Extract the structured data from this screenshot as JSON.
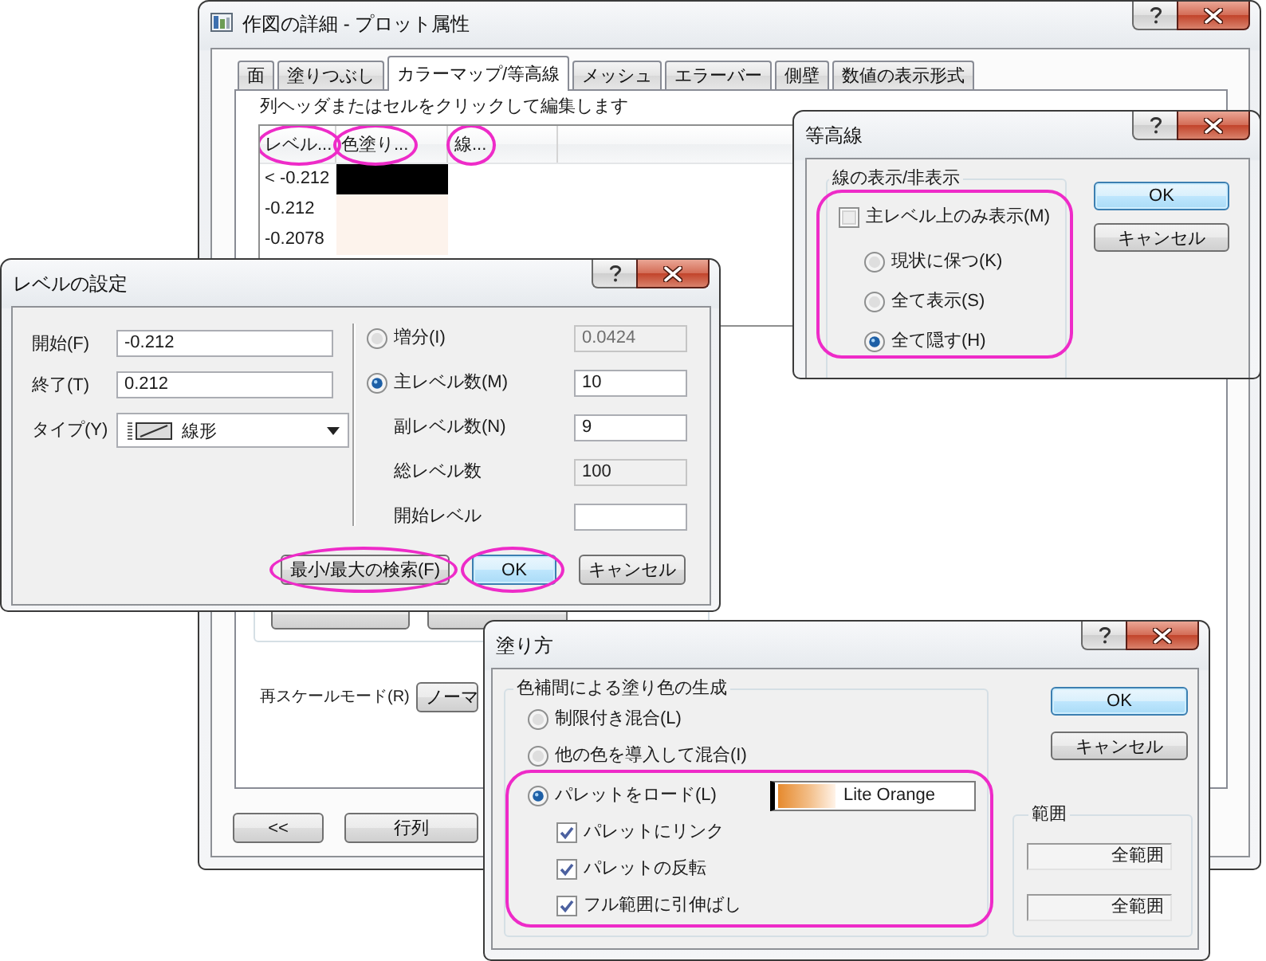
{
  "main_window": {
    "title": "作図の詳細 - プロット属性",
    "tabs": [
      {
        "label": "面",
        "selected": false
      },
      {
        "label": "塗りつぶし",
        "selected": false
      },
      {
        "label": "カラーマップ/等高線",
        "selected": true
      },
      {
        "label": "メッシュ",
        "selected": false
      },
      {
        "label": "エラーバー",
        "selected": false
      },
      {
        "label": "側壁",
        "selected": false
      },
      {
        "label": "数値の表示形式",
        "selected": false
      }
    ],
    "instruction": "列ヘッダまたはセルをクリックして編集します",
    "table": {
      "columns": [
        {
          "label": "レベル...",
          "highlighted": true
        },
        {
          "label": "色塗り...",
          "highlighted": true
        },
        {
          "label": "線...",
          "highlighted": true
        }
      ],
      "rows": [
        {
          "level": "< -0.212",
          "color": "#000000"
        },
        {
          "level": "-0.212",
          "color": "#fdf3ec"
        },
        {
          "level": "-0.2078",
          "color": "#fdf3ec"
        }
      ]
    },
    "rescale": {
      "label": "再スケールモード(R)",
      "value": "ノーマ"
    },
    "buttons": [
      "<<",
      "行列"
    ]
  },
  "level_dialog": {
    "title": "レベルの設定",
    "fields": [
      {
        "label": "開始(F)",
        "value": "-0.212"
      },
      {
        "label": "終了(T)",
        "value": "0.212"
      }
    ],
    "type": {
      "label": "タイプ(Y)",
      "value": "線形"
    },
    "options": [
      {
        "kind": "radio",
        "label": "増分(I)",
        "selected": false,
        "value": "0.0424",
        "disabled": true,
        "read_only": false
      },
      {
        "kind": "radio",
        "label": "主レベル数(M)",
        "selected": true,
        "value": "10",
        "disabled": false,
        "read_only": false
      },
      {
        "kind": "plain",
        "label": "副レベル数(N)",
        "value": "9",
        "disabled": false,
        "read_only": false
      },
      {
        "kind": "plain",
        "label": "総レベル数",
        "value": "100",
        "disabled": false,
        "read_only": true
      },
      {
        "kind": "plain",
        "label": "開始レベル",
        "disabled": false,
        "read_only": false
      }
    ],
    "buttons": [
      {
        "label": "最小/最大の検索(F)",
        "default": false,
        "highlighted": true
      },
      {
        "label": "OK",
        "default": true,
        "highlighted": true
      },
      {
        "label": "キャンセル",
        "default": false,
        "highlighted": false
      }
    ]
  },
  "contour_dialog": {
    "title": "等高線",
    "group": {
      "title": "線の表示/非表示",
      "highlighted": true,
      "checkbox": {
        "label": "主レベル上のみ表示(M)",
        "checked": false
      },
      "radios": [
        {
          "label": "現状に保つ(K)",
          "selected": false
        },
        {
          "label": "全て表示(S)",
          "selected": false
        },
        {
          "label": "全て隠す(H)",
          "selected": true
        }
      ]
    },
    "buttons": [
      {
        "label": "OK",
        "default": true
      },
      {
        "label": "キャンセル",
        "default": false
      }
    ]
  },
  "fill_dialog": {
    "title": "塗り方",
    "group": {
      "title": "色補間による塗り色の生成",
      "options": [
        {
          "kind": "radio",
          "label": "制限付き混合(L)",
          "selected": false,
          "highlighted": false
        },
        {
          "kind": "radio",
          "label": "他の色を導入して混合(I)",
          "selected": false,
          "highlighted": false
        },
        {
          "kind": "radio",
          "label": "パレットをロード(L)",
          "selected": true,
          "highlighted": true,
          "palette": "Lite Orange"
        },
        {
          "kind": "checkbox",
          "label": "パレットにリンク",
          "checked": true,
          "highlighted": true
        },
        {
          "kind": "checkbox",
          "label": "パレットの反転",
          "checked": true,
          "highlighted": true
        },
        {
          "kind": "checkbox",
          "label": "フル範囲に引伸ばし",
          "checked": true,
          "highlighted": true
        }
      ]
    },
    "buttons": [
      {
        "label": "OK",
        "default": true
      },
      {
        "label": "キャンセル",
        "default": false
      }
    ],
    "range": {
      "title": "範囲",
      "fields": [
        "全範囲",
        "全範囲"
      ]
    }
  }
}
